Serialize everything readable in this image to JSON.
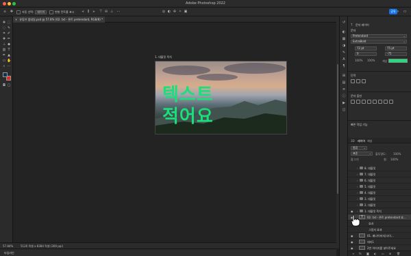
{
  "app": {
    "title": "Adobe Photoshop 2022"
  },
  "options_bar": {
    "auto_select_label": "자동 선택:",
    "auto_select_value": "레이어",
    "transform_controls_label": "변형 컨트롤 표시",
    "share_label": "공유"
  },
  "document_tab": {
    "label": "유튜브 썸네일.psd @ 57.8% (02. txt - 폰트 pretendard, RGB/8) *"
  },
  "canvas": {
    "artboard_label": "1. 대블릿 목치",
    "text_line1": "텍스트",
    "text_line2": "적어요"
  },
  "status": {
    "zoom": "57.84%",
    "doc_size": "5120 픽셀 x 8384 픽셀 (300 ppi)",
    "timeline_label": "타임라인"
  },
  "colors": {
    "foreground": "#0f3350",
    "background": "#e02a20",
    "text_color": "#19e07a",
    "accent": "#1473e6"
  },
  "properties": {
    "layer_type": "문자 레이어",
    "character_heading": "문자",
    "font_family": "Pretendard",
    "font_style": "ExtraBold",
    "font_size": "72 pt",
    "leading": "75 pt",
    "kerning": "0",
    "tracking": "-75",
    "scale_v": "100%",
    "scale_h": "100%",
    "color_label": "색상",
    "paragraph_heading": "단락",
    "warp_heading": "문자 옵션",
    "quick_actions_heading": "빠른 작업 기능"
  },
  "layers_panel": {
    "tabs": [
      "3D",
      "레이어",
      "채널"
    ],
    "kind_label": "종류",
    "blend_mode": "표준",
    "opacity_label": "불투명도:",
    "opacity_value": "100%",
    "lock_label": "잠그기:",
    "fill_label": "칠:",
    "fill_value": "100%",
    "rows": [
      {
        "name": "8. 대블릿",
        "type": "group",
        "visible": false
      },
      {
        "name": "7. 대블릿",
        "type": "group",
        "visible": false
      },
      {
        "name": "6. 대블릿",
        "type": "group",
        "visible": false
      },
      {
        "name": "5. 대블릿",
        "type": "group",
        "visible": false
      },
      {
        "name": "4. 대블릿",
        "type": "group",
        "visible": false
      },
      {
        "name": "3. 대블릿",
        "type": "group",
        "visible": false
      },
      {
        "name": "2. 대블릿",
        "type": "group",
        "visible": false
      },
      {
        "name": "1. 대블릿 목치",
        "type": "group",
        "visible": true
      },
      {
        "name": "02. txt - 폰트 pretendard 효...",
        "type": "text",
        "visible": true
      },
      {
        "name": "효과",
        "type": "fx",
        "visible": false
      },
      {
        "name": "그림자 효과",
        "type": "fx",
        "visible": false
      },
      {
        "name": "01. 배너이미지(사이...",
        "type": "image",
        "visible": true
      },
      {
        "name": "대지1",
        "type": "image",
        "visible": true
      },
      {
        "name": "2번 이미지를 넣어주세요",
        "type": "image",
        "visible": true
      }
    ]
  }
}
